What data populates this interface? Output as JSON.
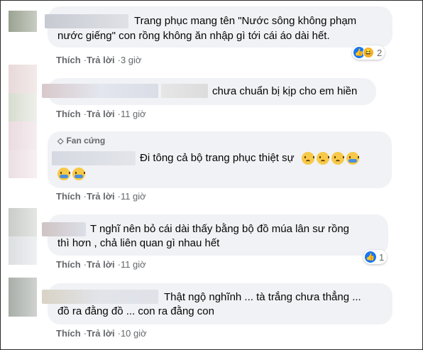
{
  "actions": {
    "like": "Thích",
    "reply": "Trả lời",
    "dot": "·"
  },
  "badge": {
    "label": "Fan cứng"
  },
  "comments": [
    {
      "lines": [
        "Trang phục mang tên \"Nước sông không phạm",
        "nước giếng\" con rồng không ăn nhập gì tới cái áo dài hết."
      ],
      "time": "3 giờ",
      "reactions": {
        "icons": [
          "like-icon",
          "haha-icon"
        ],
        "count": "2"
      }
    },
    {
      "lines": [
        "chưa chuẩn bị kịp cho em hiền"
      ],
      "time": "11 giờ"
    },
    {
      "lines": [
        "Đi tông cả bộ trang phục thiệt sự"
      ],
      "emojis_line1": [
        "sad",
        "sad",
        "sad",
        "cry"
      ],
      "emojis_line2": [
        "cry",
        "cry"
      ],
      "time": "11 giờ"
    },
    {
      "lines": [
        "T nghĩ nên bỏ cái dài thấy bằng bộ đồ múa lân sư rồng",
        "thì hơn , chả liên quan gì nhau hết"
      ],
      "time": "11 giờ",
      "reactions": {
        "icons": [
          "like-icon"
        ],
        "count": "1"
      }
    },
    {
      "lines": [
        "Thật ngộ nghĩnh ... tà trắng chưa thẳng ...",
        "đồ ra đằng đồ ... con ra đằng con"
      ],
      "time": "10 giờ"
    }
  ],
  "colors": {
    "bubble": "#f0f2f5",
    "meta": "#65676b",
    "like_blue": "#1877f2"
  }
}
